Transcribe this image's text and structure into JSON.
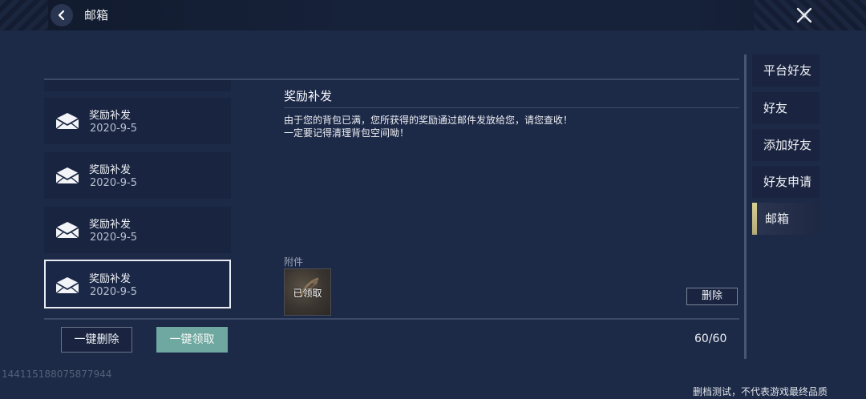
{
  "header": {
    "title": "邮箱"
  },
  "mail_list": [
    {
      "subject": "奖励补发",
      "date": "2020-9-5",
      "selected": false
    },
    {
      "subject": "奖励补发",
      "date": "2020-9-5",
      "selected": false
    },
    {
      "subject": "奖励补发",
      "date": "2020-9-5",
      "selected": false
    },
    {
      "subject": "奖励补发",
      "date": "2020-9-5",
      "selected": true
    }
  ],
  "detail": {
    "title": "奖励补发",
    "body_line1": "由于您的背包已满，您所获得的奖励通过邮件发放给您，请您查收！",
    "body_line2": "一定要记得清理背包空间呦！",
    "attachment_label": "附件",
    "attachment_status": "已领取",
    "delete_label": "删除"
  },
  "footer": {
    "delete_all_label": "一键删除",
    "claim_all_label": "一键领取",
    "count": "60/60"
  },
  "tabs": [
    {
      "label": "平台好友",
      "active": false
    },
    {
      "label": "好友",
      "active": false
    },
    {
      "label": "添加好友",
      "active": false
    },
    {
      "label": "好友申请",
      "active": false
    },
    {
      "label": "邮箱",
      "active": true
    }
  ],
  "uid": "144115188075877944",
  "disclaimer": "删档测试，不代表游戏最终品质",
  "colors": {
    "background": "#1c2947",
    "claim_button": "#6fa8a0",
    "active_tab_accent": "#c9c08d"
  },
  "icons": {
    "back": "chevron-left-icon",
    "close": "close-icon",
    "mail": "envelope-icon"
  }
}
